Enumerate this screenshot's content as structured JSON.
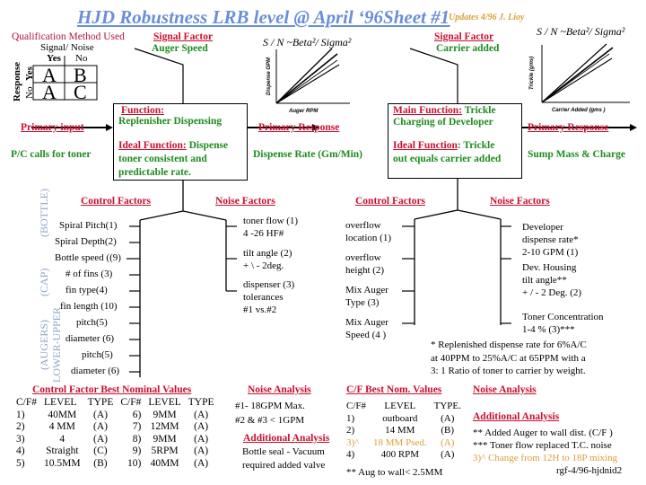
{
  "header": {
    "title": "HJD Robustness LRB level @ April ‘96Sheet #1",
    "update_note": "Updates 4/96 J. Lioy"
  },
  "qualification": {
    "heading": "Qualification Method Used",
    "signal_noise_label": "Signal/ Noise",
    "col_yes": "Yes",
    "col_no": "No",
    "response_label": "Response",
    "row_yes": "Yes",
    "row_no": "No",
    "cells": [
      [
        "A",
        "B"
      ],
      [
        "A",
        "C"
      ]
    ]
  },
  "left_diagram": {
    "signal_factor_heading": "Signal Factor",
    "signal_factor_value": "Auger Speed",
    "sn_formula": "S / N  ~Beta²/ Sigma²",
    "y_axis": "Dispense GPM",
    "x_axis": "Auger RPM",
    "primary_input_heading": "Primary input",
    "primary_input_value": "P/C calls for toner",
    "function_heading": "Function:",
    "function_value": "Replenisher Dispensing",
    "ideal_function_heading": "Ideal Function:",
    "ideal_function_value_1": " Dispense",
    "ideal_function_value_2": "toner consistent and",
    "ideal_function_value_3": "predictable rate.",
    "primary_response_heading": "Primary Response",
    "primary_response_value": "Dispense Rate (Gm/Min)",
    "control_factors_heading": "Control Factors",
    "noise_factors_heading": "Noise Factors",
    "group_labels": {
      "bottle": "(BOTTLE)",
      "cap": "(CAP)",
      "augers": "(AUGERS)",
      "lower_upper": "LOWER-UPPER"
    },
    "control_factors": [
      "Spiral Pitch(1)",
      "Spiral Depth(2)",
      "Bottle speed ((9)",
      "# of fins (3)",
      "fin type(4)",
      "fin length (10)",
      "pitch(5)",
      "diameter (6)",
      "pitch(5)",
      "diameter (6)"
    ],
    "noise_factors": [
      [
        "toner flow (1)",
        "4 -26 HF#"
      ],
      [
        "tilt  angle (2)",
        "+ \\ - 2deg."
      ],
      [
        "dispenser (3)",
        "tolerances",
        "#1 vs.#2"
      ]
    ]
  },
  "right_diagram": {
    "signal_factor_heading": "Signal Factor",
    "signal_factor_value": "Carrier added",
    "sn_formula": "S / N  ~Beta²/ Sigma²",
    "y_axis": "Trickle (gms)",
    "x_axis": "Carrier Added  (gms )",
    "main_function_heading": "Main Function:",
    "main_function_value_1": " Trickle",
    "main_function_value_2": "Charging of Developer",
    "ideal_function_heading": "Ideal Function",
    "ideal_function_value_1": ": Trickle",
    "ideal_function_value_2": "out equals carrier added",
    "primary_response_heading": "Primary Response",
    "primary_response_value": "Sump Mass & Charge",
    "control_factors_heading": "Control Factors",
    "noise_factors_heading": "Noise Factors",
    "control_factors": [
      [
        "overflow",
        "location (1)"
      ],
      [
        "overflow",
        "height (2)"
      ],
      [
        "Mix Auger",
        "Type (3)"
      ],
      [
        "Mix Auger",
        "Speed (4 )"
      ]
    ],
    "noise_factors": [
      [
        "Developer",
        "dispense rate*",
        "2-10 GPM (1)"
      ],
      [
        "Dev. Housing",
        "tilt angle**",
        "+ / - 2 Deg. (2)"
      ],
      [
        "Toner Concentration",
        "1-4 % (3)***"
      ]
    ],
    "footnote": [
      "* Replenished dispense rate for 6%A/C",
      "at 40PPM to 25%A/C at 65PPM with a",
      "3: 1 Ratio of toner to carrier by weight."
    ]
  },
  "best_nominal_left": {
    "heading": "Control Factor Best Nominal Values",
    "columns": [
      "C/F#",
      "LEVEL",
      "TYPE",
      "C/F#",
      "LEVEL",
      "TYPE"
    ],
    "rows": [
      [
        "1)",
        "40MM",
        "(A)",
        "6)",
        "9MM",
        "(A)"
      ],
      [
        "2)",
        "4 MM",
        "(A)",
        "7)",
        "12MM",
        "(A)"
      ],
      [
        "3)",
        "4",
        "(A)",
        "8)",
        "9MM",
        "(A)"
      ],
      [
        "4)",
        "Straight",
        "(C)",
        "9)",
        "5RPM",
        "(A)"
      ],
      [
        "5)",
        "10.5MM",
        "(B)",
        "10)",
        "40MM",
        "(A)"
      ]
    ]
  },
  "noise_analysis_left": {
    "heading": "Noise Analysis",
    "lines": [
      "#1- 18GPM Max.",
      "#2 & #3 < 1GPM"
    ],
    "additional_heading": "Additional Analysis",
    "additional_lines": [
      "Bottle seal - Vacuum",
      "required added valve"
    ]
  },
  "best_nominal_right": {
    "heading": "C/F  Best Nom. Values",
    "columns": [
      "C/F#",
      "LEVEL",
      "TYPE."
    ],
    "rows": [
      [
        "1)",
        "outboard",
        "(A)"
      ],
      [
        "2)",
        "14 MM",
        "(B)"
      ],
      [
        "3)^",
        "18 MM Psed.",
        "(A)"
      ],
      [
        "4)",
        "400 RPM",
        "(A)"
      ]
    ],
    "highlight_row": 2,
    "note": "**  Aug to wall< 2.5MM"
  },
  "noise_analysis_right": {
    "heading": "Noise Analysis",
    "additional_heading": "Additional Analysis",
    "lines": [
      "** Added Auger to wall dist. (C/F )",
      "*** Toner flow replaced T.C. noise"
    ],
    "highlight_line": "3)^ Change from 12H to 18P mixing",
    "signature": "rgf-4/96-hjdnid2"
  },
  "colors": {
    "title_blue": "#6a8fd8",
    "heading_red": "#c8102e",
    "value_green": "#1e8c1e",
    "update_gold": "#d9a03a",
    "group_label_blue": "#8ea6c8"
  }
}
